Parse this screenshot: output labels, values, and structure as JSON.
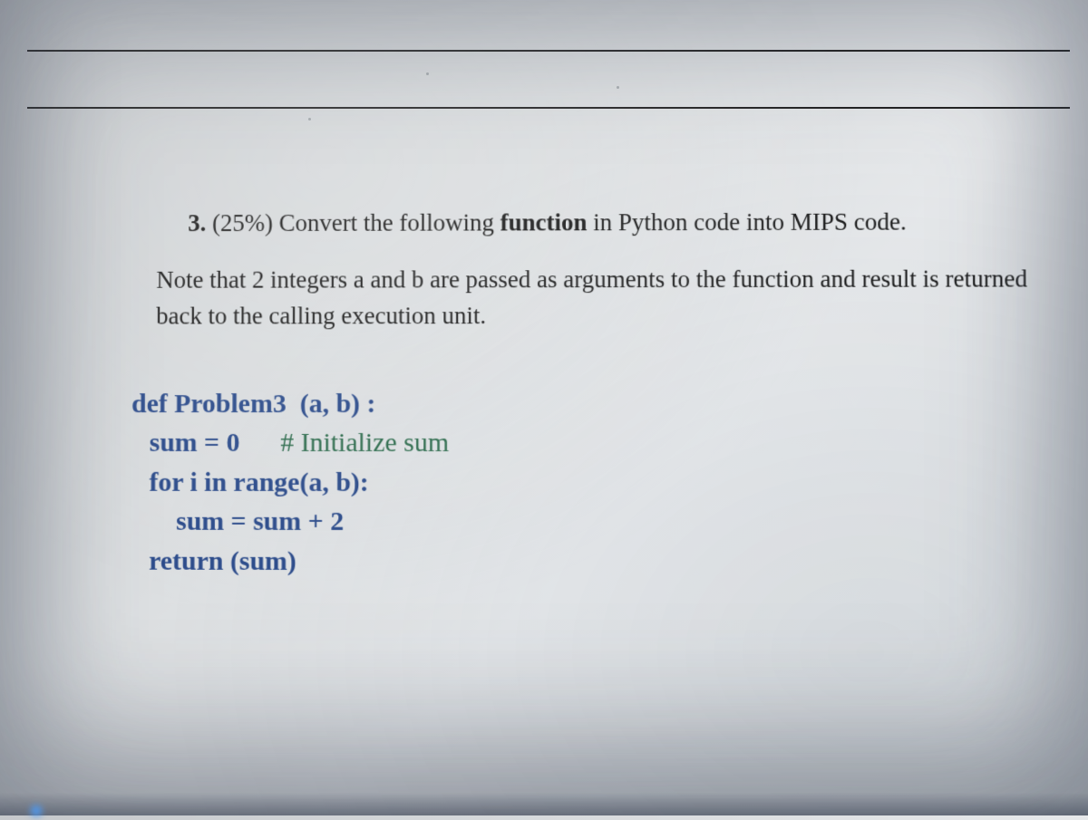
{
  "problem": {
    "number": "3.",
    "weight": "(25%)",
    "prompt_prefix": "Convert the following ",
    "prompt_bold": "function",
    "prompt_suffix": " in Python code into MIPS code.",
    "note": "Note that 2 integers a and b are passed as arguments to the function and result is returned back to the calling execution unit."
  },
  "code": {
    "line1_def": "def",
    "line1_name": " Problem3  ",
    "line1_params": "(a, b) :",
    "line2_stmt": "sum = 0",
    "line2_comment": "      # Initialize sum",
    "line3": "for i in range(a, b):",
    "line4": "sum = sum + 2",
    "line5": "return (sum)"
  }
}
